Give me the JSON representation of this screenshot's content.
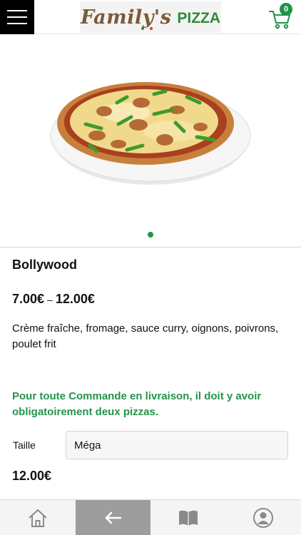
{
  "header": {
    "logo_script": "Family's",
    "logo_word": "PIZZA",
    "cart_count": "0",
    "logo_dot_colors": [
      "#2e8b3a",
      "#ffffff",
      "#d23a2a"
    ]
  },
  "product": {
    "name": "Bollywood",
    "price_min": "7.00€",
    "price_separator": "–",
    "price_max": "12.00€",
    "description": "Crème fraîche, fromage, sauce curry, oignons, poivrons, poulet frit",
    "notice": "Pour toute Commande en livraison, il doit y avoir obligatoirement deux pizzas.",
    "size_label": "Taille",
    "size_selected": "Méga",
    "total": "12.00€"
  },
  "carousel": {
    "slide_count": 1,
    "active_slide": 1
  },
  "bottom_nav": {
    "items": [
      {
        "icon": "home-icon",
        "active": false
      },
      {
        "icon": "back-arrow-icon",
        "active": true
      },
      {
        "icon": "menu-book-icon",
        "active": false
      },
      {
        "icon": "account-icon",
        "active": false
      }
    ]
  },
  "colors": {
    "accent_green": "#1f9447",
    "notice_green": "#23944b",
    "logo_brown": "#7a5a3a",
    "active_nav": "#9d9d9d"
  }
}
